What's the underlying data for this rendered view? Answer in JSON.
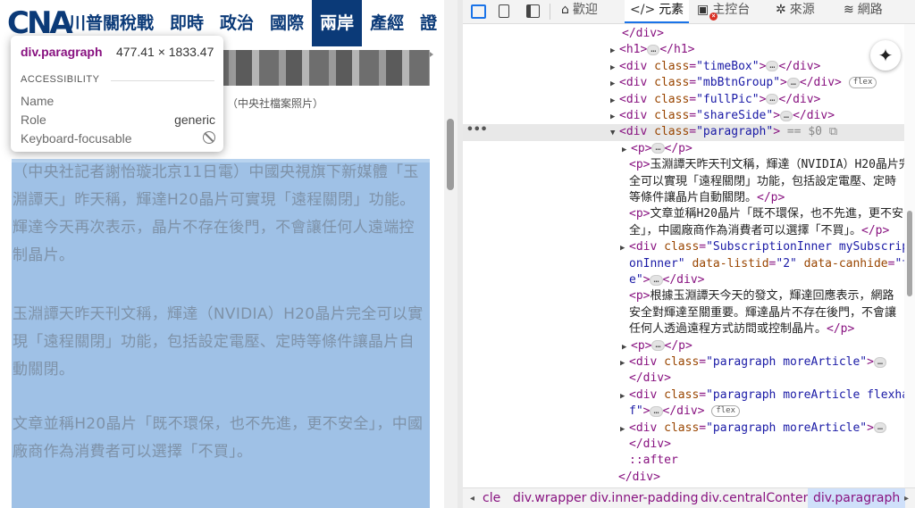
{
  "page": {
    "logo": "CNA",
    "nav": [
      "川普關稅戰",
      "即時",
      "政治",
      "國際",
      "兩岸",
      "產經",
      "證"
    ],
    "active_nav": "兩岸",
    "photo_caption": "（中央社檔案照片）",
    "paragraphs": [
      "（中央社記者謝怡璇北京11日電）中國央視旗下新媒體「玉淵譚天」昨天稱，輝達H20晶片可實現「遠程關閉」功能。輝達今天再次表示，晶片不存在後門，不會讓任何人遠端控制晶片。",
      "玉淵譚天昨天刊文稱，輝達（NVIDIA）H20晶片完全可以實現「遠程關閉」功能，包括設定電壓、定時等條件讓晶片自動關閉。",
      "文章並稱H20晶片「既不環保，也不先進，更不安全」，中國廠商作為消費者可以選擇「不買」。"
    ]
  },
  "tooltip": {
    "tag": "div.paragraph",
    "size": "477.41 × 1833.47",
    "section": "ACCESSIBILITY",
    "rows": [
      {
        "label": "Name",
        "value": ""
      },
      {
        "label": "Role",
        "value": "generic"
      },
      {
        "label": "Keyboard-focusable",
        "value": ""
      }
    ]
  },
  "devtools": {
    "tabs": [
      {
        "label": "歡迎",
        "icon": "home-icon"
      },
      {
        "label": "元素",
        "icon": "code-icon"
      },
      {
        "label": "主控台",
        "icon": "console-icon"
      },
      {
        "label": "來源",
        "icon": "bug-icon"
      },
      {
        "label": "網路",
        "icon": "wifi-icon"
      }
    ],
    "active_tab": "元素",
    "selected_suffix": "== $0",
    "lines": [
      {
        "kind": "close",
        "text": "</div>"
      },
      {
        "kind": "simple",
        "text": "<h1>",
        "after": "</h1>"
      },
      {
        "kind": "div",
        "cls": "timeBox"
      },
      {
        "kind": "div",
        "cls": "mbBtnGroup",
        "badge": "flex"
      },
      {
        "kind": "div",
        "cls": "fullPic"
      },
      {
        "kind": "div",
        "cls": "shareSide"
      },
      {
        "kind": "selected",
        "cls": "paragraph"
      },
      {
        "kind": "p"
      },
      {
        "kind": "ptext",
        "text": "<p>玉淵譚天昨天刊文稱，輝達（NVIDIA）H20晶片完"
      },
      {
        "kind": "cont",
        "text": "全可以實現「遠程關閉」功能，包括設定電壓、定時"
      },
      {
        "kind": "cont",
        "text": "等條件讓晶片自動關閉。</p>"
      },
      {
        "kind": "ptext",
        "text": "<p>文章並稱H20晶片「既不環保，也不先進，更不安"
      },
      {
        "kind": "cont",
        "text": "全」，中國廠商作為消費者可以選擇「不買」。</p>"
      },
      {
        "kind": "subdiv",
        "text": "<div class=\"SubscriptionInner mySubscripti"
      },
      {
        "kind": "subdiv2",
        "text": "onInner\" data-listid=\"2\" data-canhide=\"tru"
      },
      {
        "kind": "subdiv3",
        "text": "e\">",
        "after": "</div>"
      },
      {
        "kind": "ptext",
        "text": "<p>根據玉淵譚天今天的發文，輝達回應表示，網路"
      },
      {
        "kind": "cont",
        "text": "安全對輝達至關重要。輝達晶片不存在後門，不會讓"
      },
      {
        "kind": "cont",
        "text": "任何人透過遠程方式訪問或控制晶片。</p>"
      },
      {
        "kind": "p"
      },
      {
        "kind": "more",
        "cls": "paragraph moreArticle"
      },
      {
        "kind": "close2",
        "text": "</div>"
      },
      {
        "kind": "more",
        "cls": "paragraph moreArticle flexhal"
      },
      {
        "kind": "morecont",
        "text": "f\">",
        "after": "</div>",
        "badge": "flex"
      },
      {
        "kind": "more",
        "cls": "paragraph moreArticle"
      },
      {
        "kind": "close2",
        "text": "</div>"
      },
      {
        "kind": "pseudo",
        "text": "::after"
      },
      {
        "kind": "close3",
        "text": "</div>"
      }
    ],
    "breadcrumb": [
      "cle",
      "div.wrapper",
      "div.inner-padding",
      "div.centralContent",
      "div.paragraph"
    ]
  }
}
